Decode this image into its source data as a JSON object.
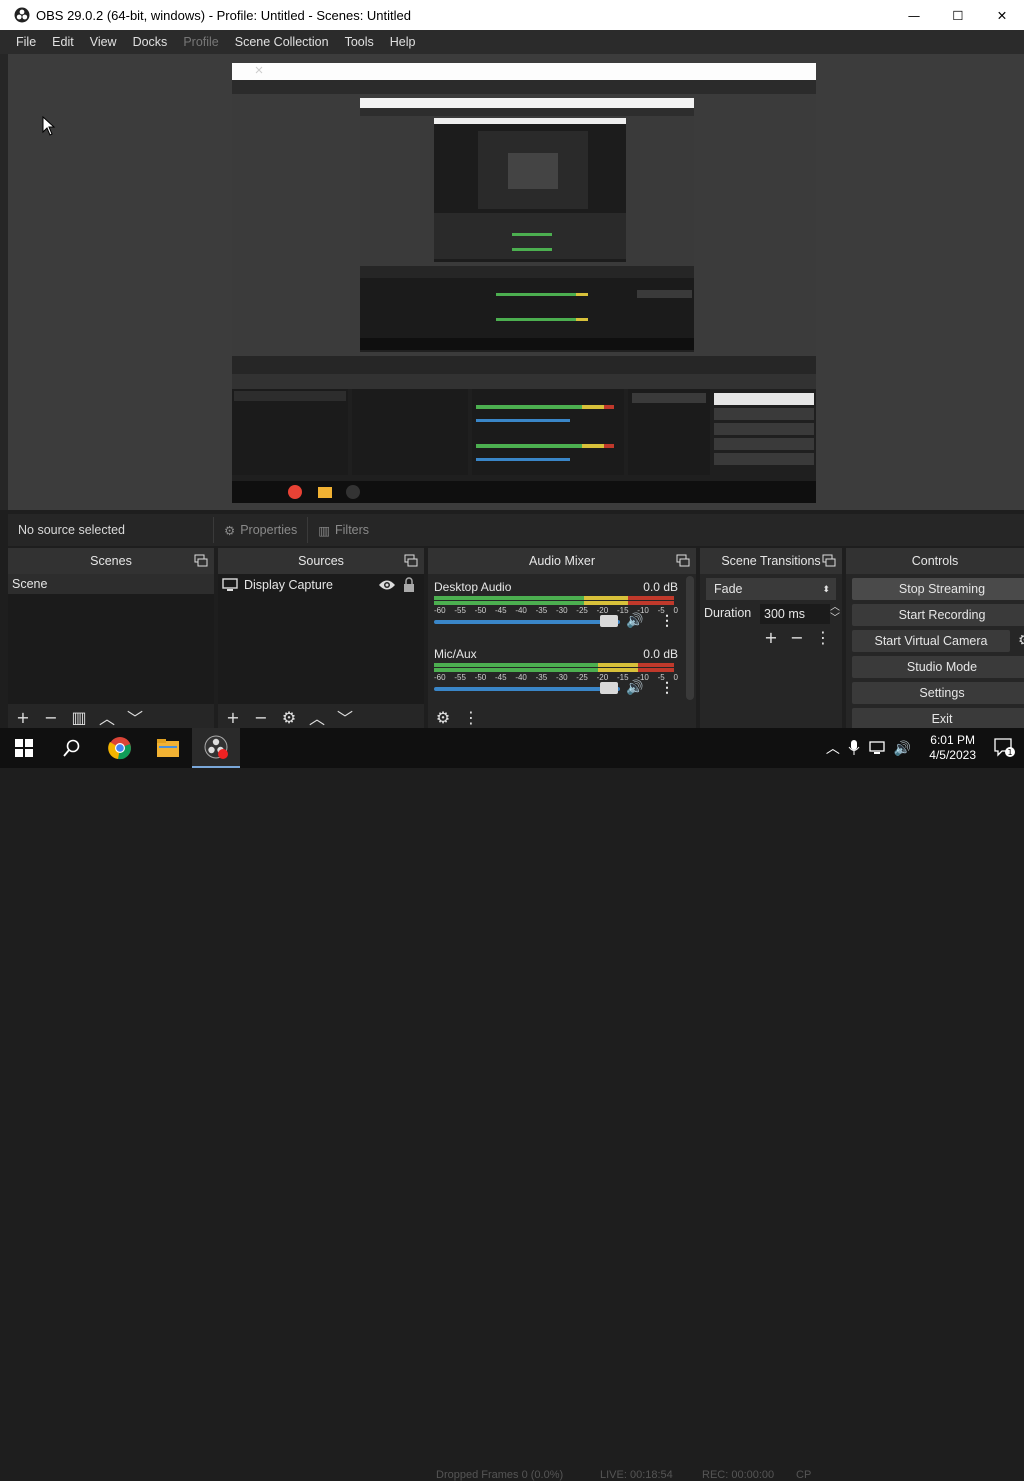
{
  "window": {
    "title": "OBS 29.0.2 (64-bit, windows) - Profile: Untitled - Scenes: Untitled",
    "minimize": "—",
    "maximize": "☐",
    "close": "✕"
  },
  "menu": [
    "File",
    "Edit",
    "View",
    "Docks",
    "Profile",
    "Scene Collection",
    "Tools",
    "Help"
  ],
  "status": {
    "no_source": "No source selected",
    "properties": "Properties",
    "filters": "Filters"
  },
  "docks": {
    "scenes": {
      "title": "Scenes",
      "items": [
        "Scene"
      ]
    },
    "sources": {
      "title": "Sources",
      "items": [
        "Display Capture"
      ]
    },
    "mixer": {
      "title": "Audio Mixer",
      "channels": [
        {
          "name": "Desktop Audio",
          "db": "0.0 dB"
        },
        {
          "name": "Mic/Aux",
          "db": "0.0 dB"
        }
      ],
      "scale": [
        "-60",
        "-55",
        "-50",
        "-45",
        "-40",
        "-35",
        "-30",
        "-25",
        "-20",
        "-15",
        "-10",
        "-5",
        "0"
      ]
    },
    "transitions": {
      "title": "Scene Transitions",
      "selected": "Fade",
      "duration_label": "Duration",
      "duration_value": "300 ms"
    },
    "controls": {
      "title": "Controls",
      "buttons": [
        "Stop Streaming",
        "Start Recording",
        "Start Virtual Camera",
        "Studio Mode",
        "Settings",
        "Exit"
      ]
    }
  },
  "statusbar_behind": {
    "dropped": "Dropped Frames 0 (0.0%)",
    "live": "LIVE: 00:18:54",
    "rec": "REC: 00:00:00",
    "cpu": "CP"
  },
  "taskbar": {
    "time": "6:01 PM",
    "date": "4/5/2023"
  },
  "colors": {
    "accent": "#3a86c8",
    "meter_green": "#4caf50",
    "meter_yellow": "#d8c13a",
    "meter_red": "#c0392b"
  }
}
